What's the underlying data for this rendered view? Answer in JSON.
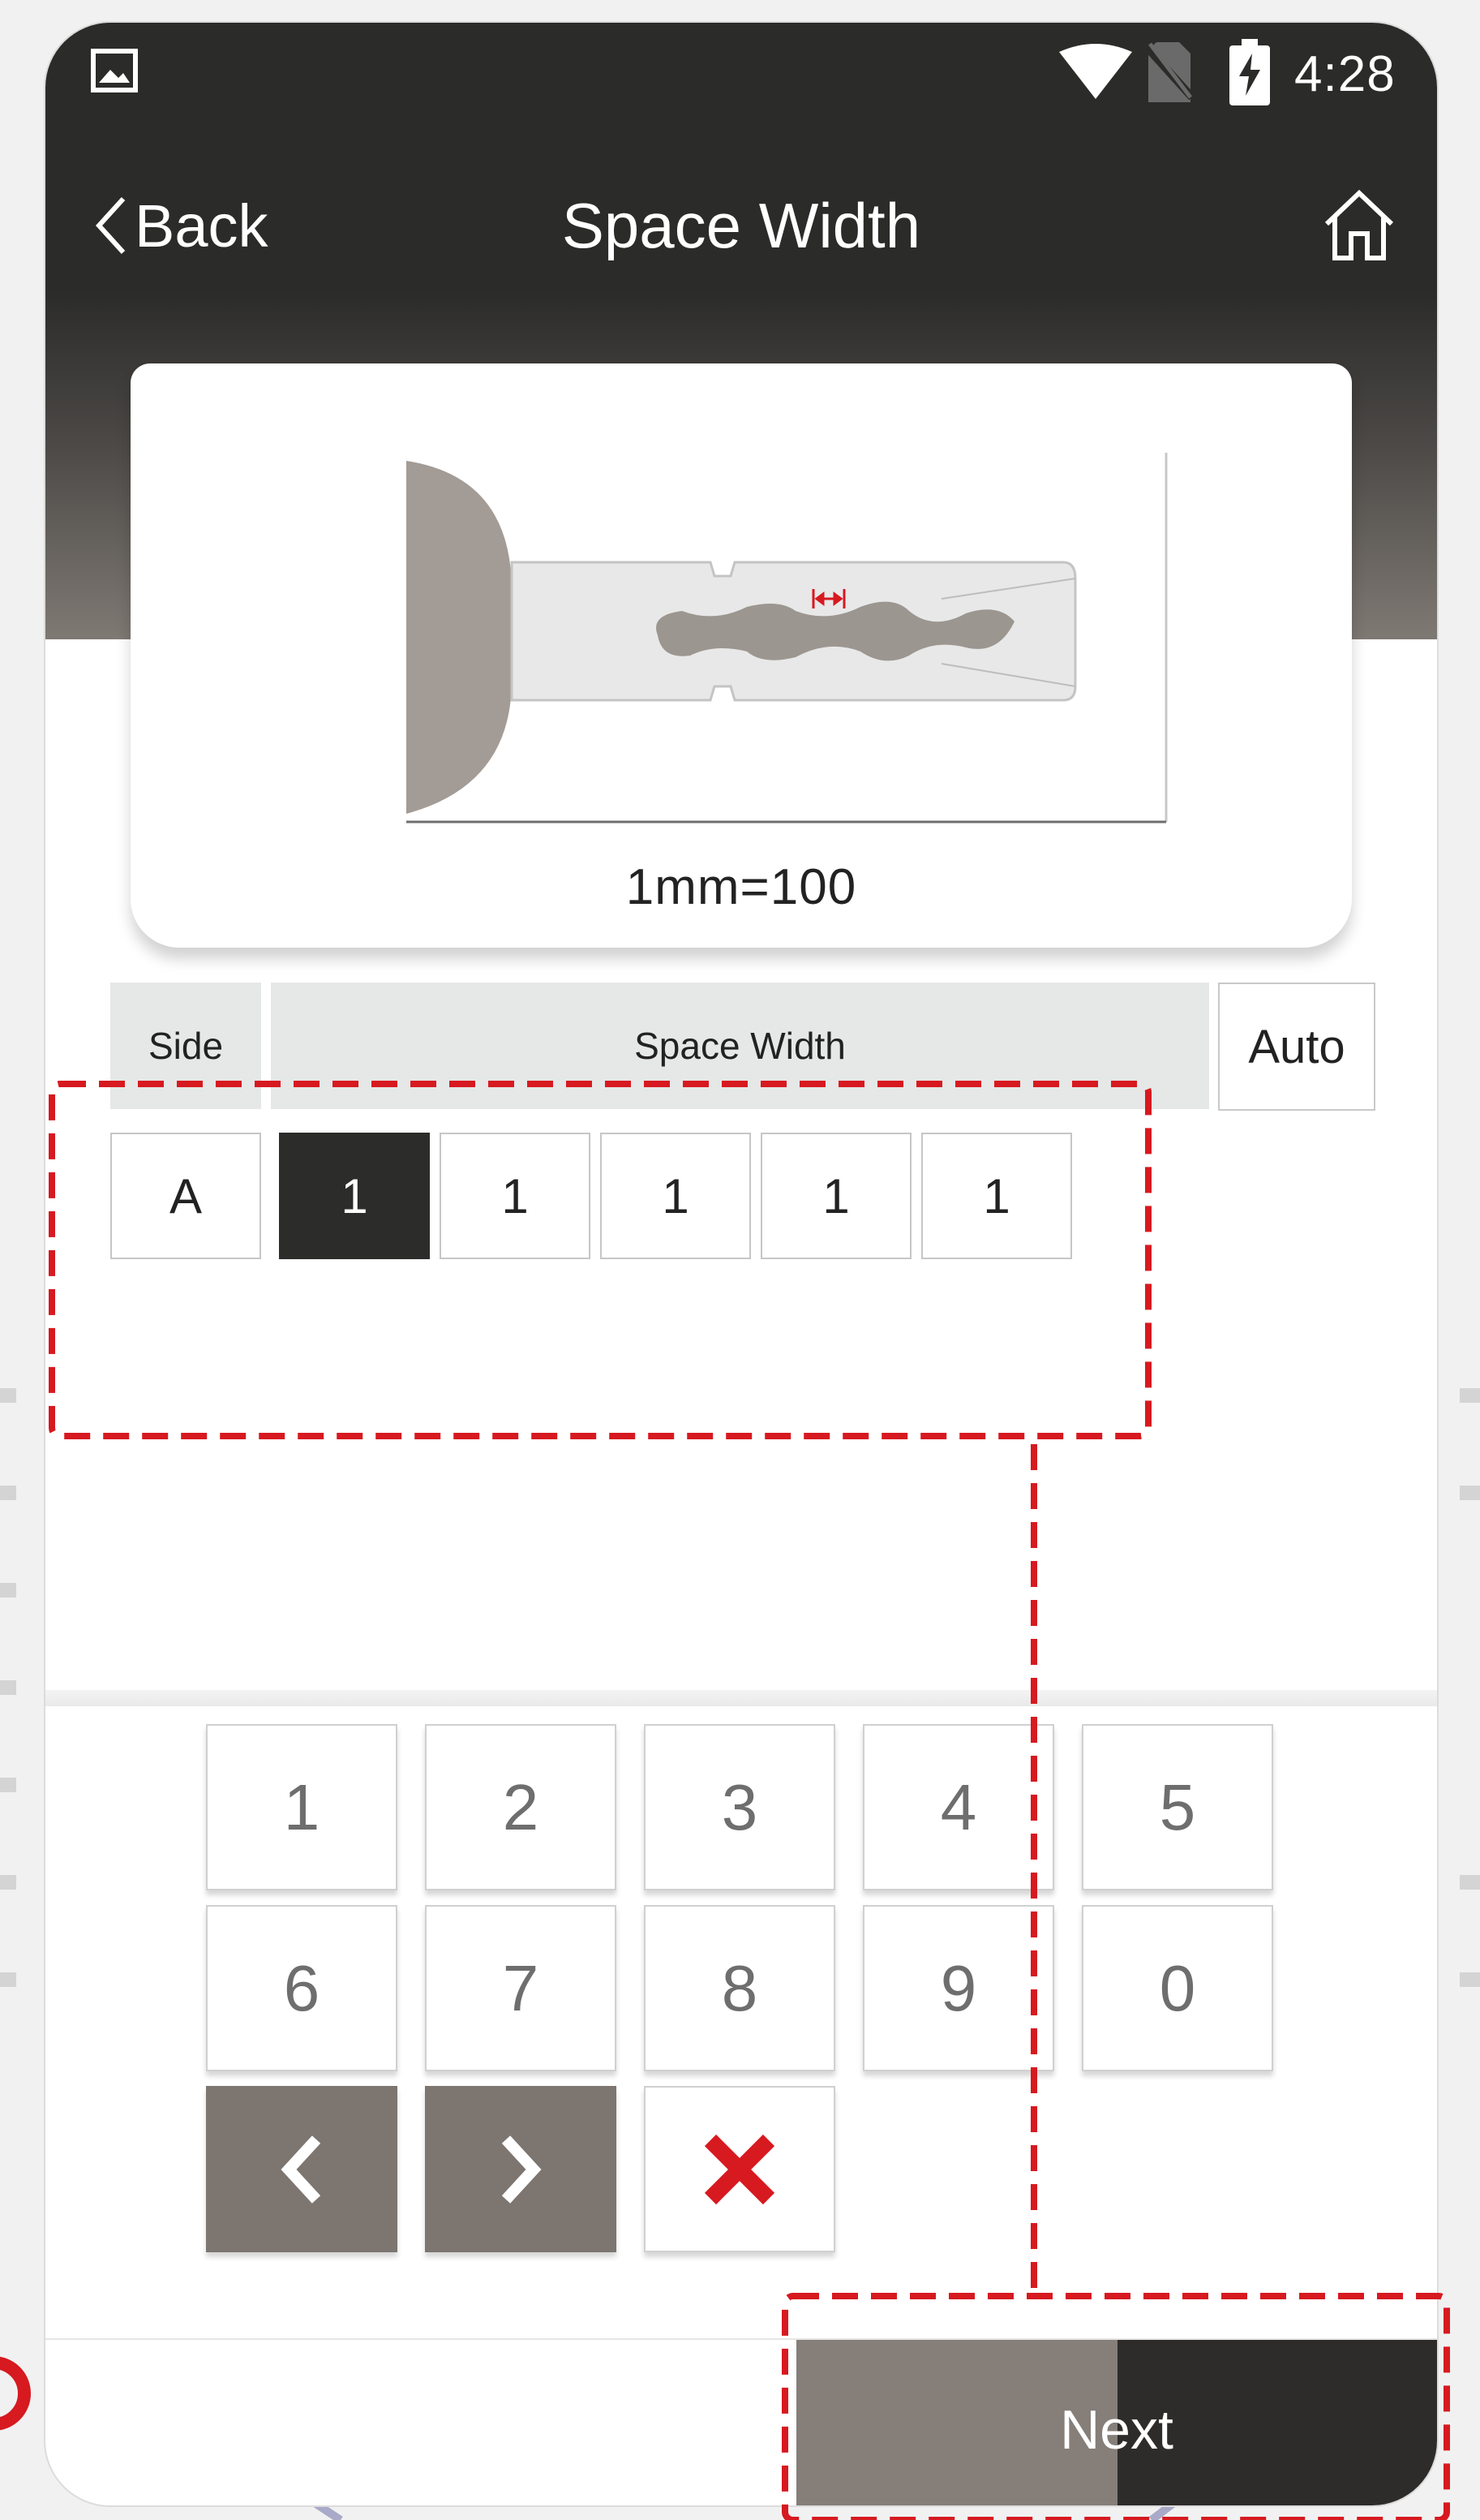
{
  "status_bar": {
    "time": "4:28",
    "icons": [
      "image-icon",
      "wifi-icon",
      "no-sim-icon",
      "battery-charging-icon"
    ]
  },
  "header": {
    "back_label": "Back",
    "title": "Space Width",
    "home_icon": "home-icon"
  },
  "diagram": {
    "scale_label": "1mm=100",
    "marker_icon": "width-arrow-icon"
  },
  "table": {
    "side_header": "Side",
    "width_header": "Space Width",
    "auto_label": "Auto",
    "side_value": "A",
    "values": [
      "1",
      "1",
      "1",
      "1",
      "1"
    ],
    "selected_index": 0
  },
  "keypad": {
    "digits": [
      "1",
      "2",
      "3",
      "4",
      "5",
      "6",
      "7",
      "8",
      "9",
      "0"
    ],
    "prev_icon": "chevron-left-icon",
    "next_icon": "chevron-right-icon",
    "delete_icon": "delete-x-icon"
  },
  "footer": {
    "next_label": "Next"
  },
  "colors": {
    "header_dark": "#2b2b29",
    "accent_red": "#d71920",
    "selected_cell": "#2c2c2a",
    "nav_key": "#7c7570"
  }
}
